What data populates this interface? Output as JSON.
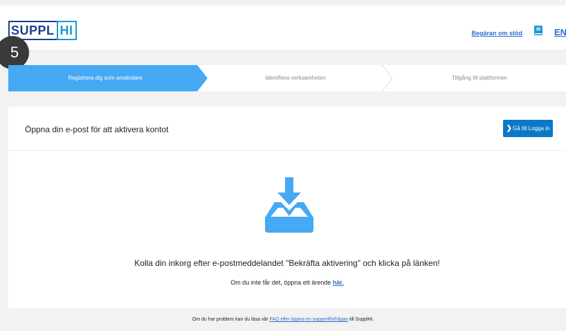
{
  "header": {
    "logo_left": "SUPPL",
    "logo_right": "HI",
    "support_link": "Begäran om stöd",
    "book_icon": "book-icon",
    "language": "EN"
  },
  "step_badge": "5",
  "steps": [
    {
      "label": "Registrera dig som användare",
      "active": true
    },
    {
      "label": "Identifiera verksamheten",
      "active": false
    },
    {
      "label": "Tillgång till plattformen",
      "active": false
    }
  ],
  "colors": {
    "accent": "#45a9f3",
    "button": "#0b79c7",
    "link": "#2a6fd1"
  },
  "card": {
    "title": "Öppna din e-post för att aktivera kontot",
    "login_button": "Gå till Logga in",
    "login_icon": "chevron-right-icon",
    "illustration_icon": "download-inbox-icon",
    "main_message": "Kolla din inkorg efter e-postmeddelandet \"Bekräfta aktivering\" och klicka på länken!",
    "sub_message_prefix": "Om du inte får det, öppna ett ärende ",
    "sub_message_link": "här."
  },
  "footer": {
    "prefix": "Om du har problem kan du läsa vår ",
    "link": "FAQ eller öppna en supportförfrågan",
    "suffix": " till SupplHi."
  }
}
